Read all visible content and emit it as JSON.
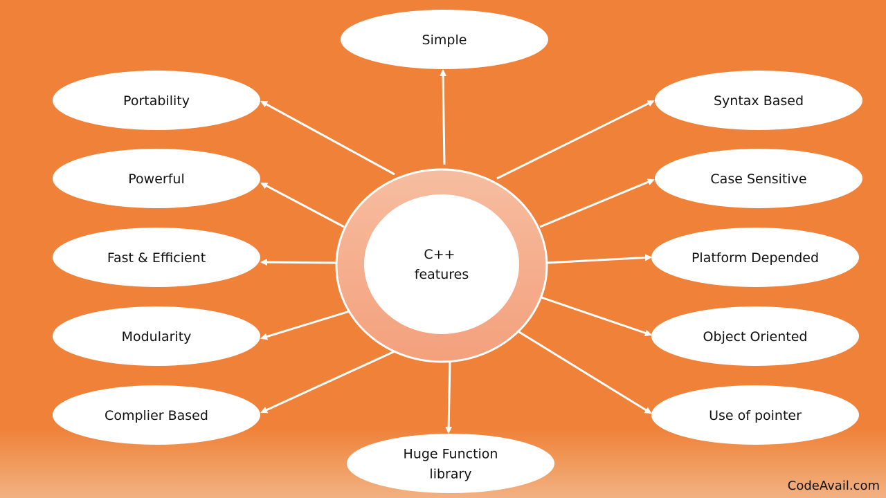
{
  "diagram": {
    "title": "C++ features",
    "center": {
      "lines": [
        "C++",
        "features"
      ]
    },
    "features": [
      {
        "id": "simple",
        "lines": [
          "Simple"
        ]
      },
      {
        "id": "portability",
        "lines": [
          "Portability"
        ]
      },
      {
        "id": "powerful",
        "lines": [
          "Powerful"
        ]
      },
      {
        "id": "fast-efficient",
        "lines": [
          "Fast & Efficient"
        ]
      },
      {
        "id": "modularity",
        "lines": [
          "Modularity"
        ]
      },
      {
        "id": "complier-based",
        "lines": [
          "Complier Based"
        ]
      },
      {
        "id": "huge-function-library",
        "lines": [
          "Huge Function",
          "library"
        ]
      },
      {
        "id": "syntax-based",
        "lines": [
          "Syntax Based"
        ]
      },
      {
        "id": "case-sensitive",
        "lines": [
          "Case Sensitive"
        ]
      },
      {
        "id": "platform-depended",
        "lines": [
          "Platform Depended"
        ]
      },
      {
        "id": "object-oriented",
        "lines": [
          "Object Oriented"
        ]
      },
      {
        "id": "use-of-pointer",
        "lines": [
          "Use of pointer"
        ]
      }
    ],
    "edges_direction": "center-to-feature"
  },
  "colors": {
    "background": "#ef8139",
    "ring": "#f5a882",
    "node_fill": "#ffffff",
    "arrow": "#ffffff",
    "text": "#111111"
  },
  "watermark": "CodeAvail.com"
}
